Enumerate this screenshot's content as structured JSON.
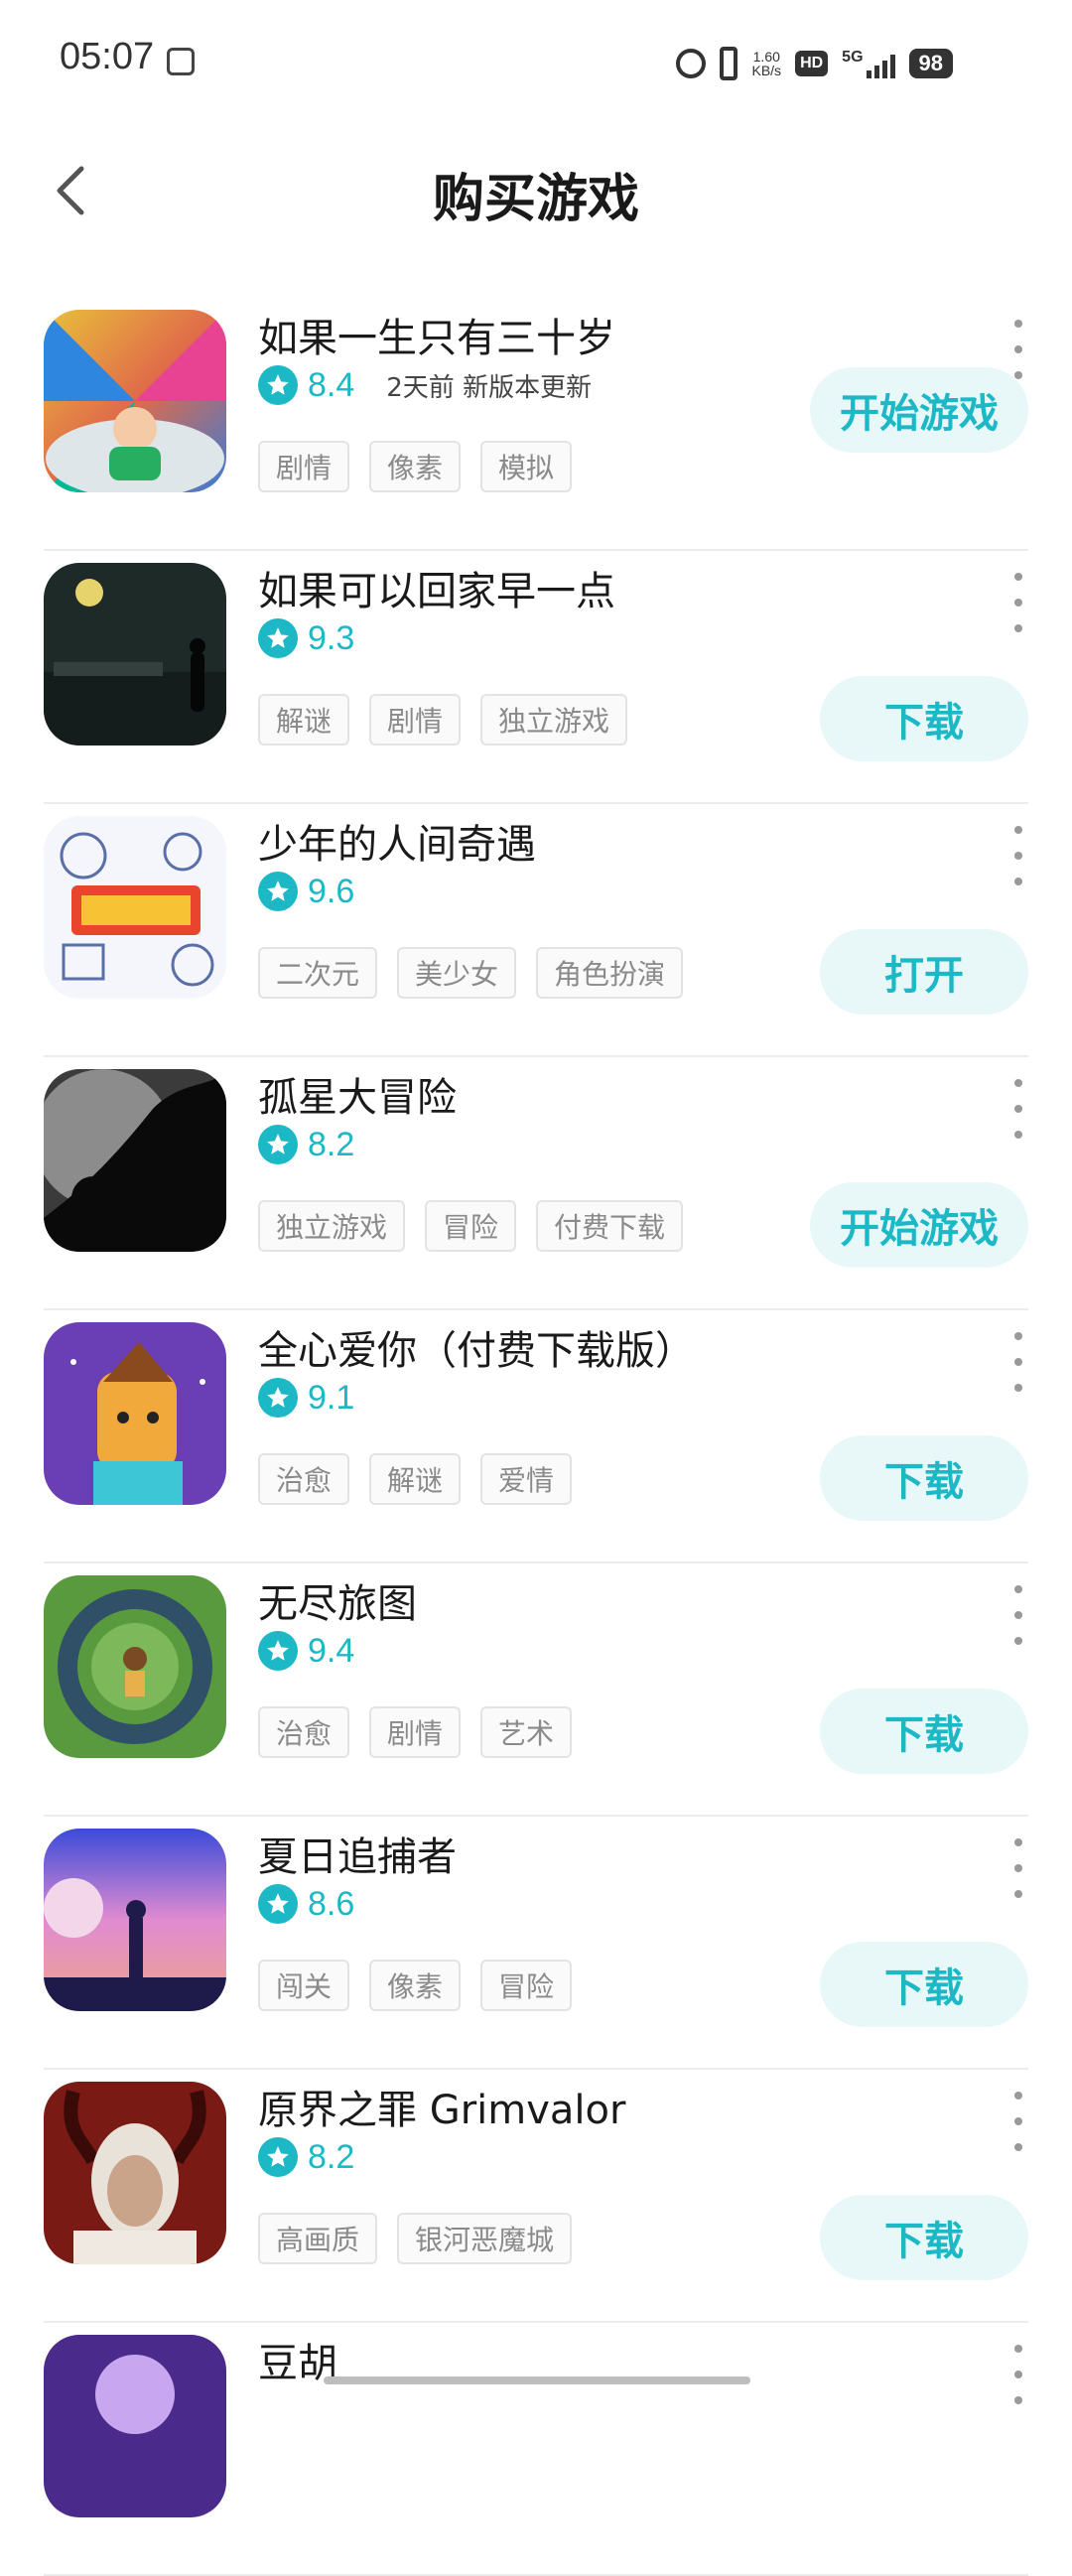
{
  "status_bar": {
    "time": "05:07",
    "net_speed_top": "1.60",
    "net_speed_bottom": "KB/s",
    "hd": "HD",
    "network": "5G",
    "battery": "98"
  },
  "header": {
    "title": "购买游戏"
  },
  "colors": {
    "accent": "#1cb8c6",
    "button_bg": "#e8f8f9",
    "tag_text": "#8a8a8a"
  },
  "games": [
    {
      "name": "如果一生只有三十岁",
      "rating": "8.4",
      "update_note": "2天前 新版本更新",
      "tags": [
        "剧情",
        "像素",
        "模拟"
      ],
      "action": "开始游戏"
    },
    {
      "name": "如果可以回家早一点",
      "rating": "9.3",
      "update_note": "",
      "tags": [
        "解谜",
        "剧情",
        "独立游戏"
      ],
      "action": "下载"
    },
    {
      "name": "少年的人间奇遇",
      "rating": "9.6",
      "update_note": "",
      "tags": [
        "二次元",
        "美少女",
        "角色扮演"
      ],
      "action": "打开"
    },
    {
      "name": "孤星大冒险",
      "rating": "8.2",
      "update_note": "",
      "tags": [
        "独立游戏",
        "冒险",
        "付费下载"
      ],
      "action": "开始游戏"
    },
    {
      "name": "全心爱你（付费下载版）",
      "rating": "9.1",
      "update_note": "",
      "tags": [
        "治愈",
        "解谜",
        "爱情"
      ],
      "action": "下载"
    },
    {
      "name": "无尽旅图",
      "rating": "9.4",
      "update_note": "",
      "tags": [
        "治愈",
        "剧情",
        "艺术"
      ],
      "action": "下载"
    },
    {
      "name": "夏日追捕者",
      "rating": "8.6",
      "update_note": "",
      "tags": [
        "闯关",
        "像素",
        "冒险"
      ],
      "action": "下载"
    },
    {
      "name": "原界之罪 Grimvalor",
      "rating": "8.2",
      "update_note": "",
      "tags": [
        "高画质",
        "银河恶魔城"
      ],
      "action": "下载"
    },
    {
      "name": "豆胡",
      "rating": "",
      "update_note": "",
      "tags": [],
      "action": ""
    }
  ]
}
